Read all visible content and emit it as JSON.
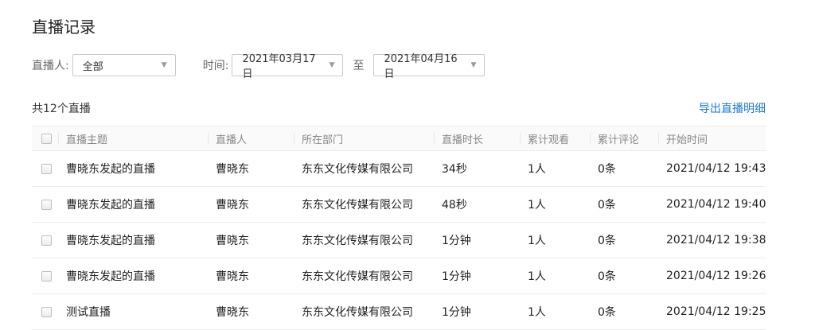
{
  "page": {
    "title": "直播记录"
  },
  "filters": {
    "person_label": "直播人:",
    "person_value": "全部",
    "time_label": "时间:",
    "start_date": "2021年03月17日",
    "to_label": "至",
    "end_date": "2021年04月16日"
  },
  "summary": "共12个直播",
  "export_label": "导出直播明细",
  "table": {
    "columns": [
      "直播主题",
      "直播人",
      "所在部门",
      "直播时长",
      "累计观看",
      "累计评论",
      "开始时间"
    ],
    "rows": [
      [
        "曹晓东发起的直播",
        "曹晓东",
        "东东文化传媒有限公司",
        "34秒",
        "1人",
        "0条",
        "2021/04/12 19:43"
      ],
      [
        "曹晓东发起的直播",
        "曹晓东",
        "东东文化传媒有限公司",
        "48秒",
        "1人",
        "0条",
        "2021/04/12 19:40"
      ],
      [
        "曹晓东发起的直播",
        "曹晓东",
        "东东文化传媒有限公司",
        "1分钟",
        "1人",
        "0条",
        "2021/04/12 19:38"
      ],
      [
        "曹晓东发起的直播",
        "曹晓东",
        "东东文化传媒有限公司",
        "1分钟",
        "1人",
        "0条",
        "2021/04/12 19:26"
      ],
      [
        "测试直播",
        "曹晓东",
        "东东文化传媒有限公司",
        "1分钟",
        "1人",
        "0条",
        "2021/04/12 19:25"
      ]
    ]
  }
}
